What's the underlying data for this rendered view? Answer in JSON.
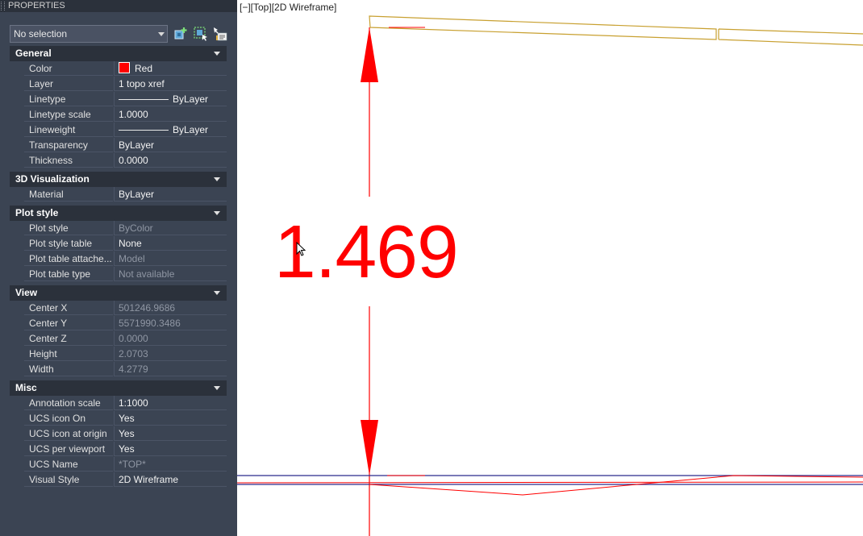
{
  "palette": {
    "title": "PROPERTIES",
    "selection": "No selection",
    "buttons": [
      "toggle-pickadd-icon",
      "select-objects-icon",
      "quick-select-icon"
    ],
    "categories": [
      {
        "label": "General",
        "rows": [
          {
            "name": "Color",
            "value": "Red",
            "swatch": "#ff0000"
          },
          {
            "name": "Layer",
            "value": "1 topo xref"
          },
          {
            "name": "Linetype",
            "value": "ByLayer",
            "line": true
          },
          {
            "name": "Linetype scale",
            "value": "1.0000"
          },
          {
            "name": "Lineweight",
            "value": "ByLayer",
            "line": true
          },
          {
            "name": "Transparency",
            "value": "ByLayer"
          },
          {
            "name": "Thickness",
            "value": "0.0000"
          }
        ]
      },
      {
        "label": "3D Visualization",
        "rows": [
          {
            "name": "Material",
            "value": "ByLayer"
          }
        ]
      },
      {
        "label": "Plot style",
        "rows": [
          {
            "name": "Plot style",
            "value": "ByColor",
            "ro": true
          },
          {
            "name": "Plot style table",
            "value": "None"
          },
          {
            "name": "Plot table attache...",
            "value": "Model",
            "ro": true
          },
          {
            "name": "Plot table type",
            "value": "Not available",
            "ro": true
          }
        ]
      },
      {
        "label": "View",
        "rows": [
          {
            "name": "Center X",
            "value": "501246.9686",
            "ro": true
          },
          {
            "name": "Center Y",
            "value": "5571990.3486",
            "ro": true
          },
          {
            "name": "Center Z",
            "value": "0.0000",
            "ro": true
          },
          {
            "name": "Height",
            "value": "2.0703",
            "ro": true
          },
          {
            "name": "Width",
            "value": "4.2779",
            "ro": true
          }
        ]
      },
      {
        "label": "Misc",
        "rows": [
          {
            "name": "Annotation scale",
            "value": "1:1000"
          },
          {
            "name": "UCS icon On",
            "value": "Yes"
          },
          {
            "name": "UCS icon at origin",
            "value": "Yes"
          },
          {
            "name": "UCS per viewport",
            "value": "Yes"
          },
          {
            "name": "UCS Name",
            "value": "*TOP*",
            "ro": true
          },
          {
            "name": "Visual Style",
            "value": "2D Wireframe"
          }
        ]
      }
    ]
  },
  "viewport": {
    "label": "[−][Top][2D Wireframe]",
    "dimension_text": "1.469"
  },
  "colors": {
    "dimension": "#ff0000",
    "boundary": "#c8a030",
    "baseline": "#2a2a8c"
  }
}
